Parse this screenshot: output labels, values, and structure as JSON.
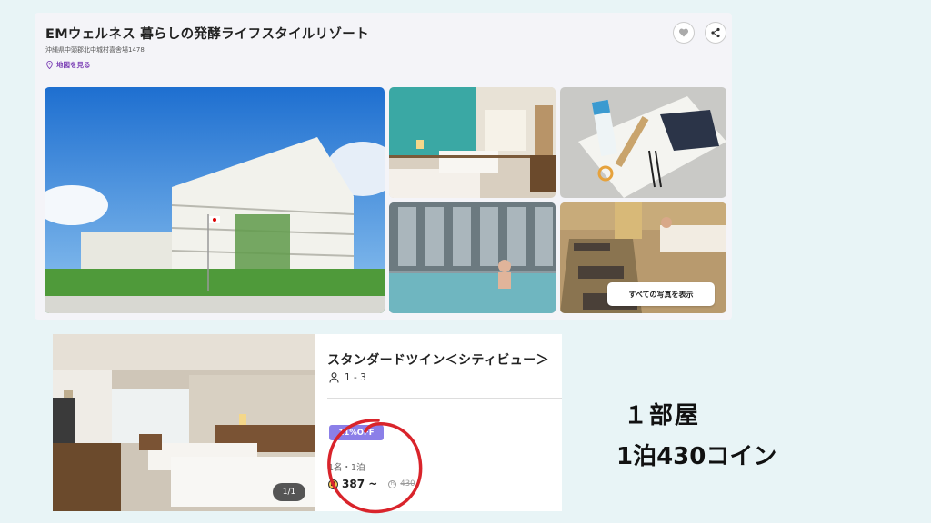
{
  "hotel": {
    "title": "EMウェルネス 暮らしの発酵ライフスタイルリゾート",
    "address": "沖縄県中頭郡北中城村喜舎場1478",
    "map_link": "地図を見る",
    "favorite_icon": "heart-icon",
    "share_icon": "share-icon",
    "show_all_photos": "すべての写真を表示"
  },
  "room": {
    "name": "スタンダードツイン＜シティビュー＞",
    "capacity": "1 - 3",
    "photo_counter": "1/1",
    "discount_badge": "11%OFF",
    "plan": "1名・1泊",
    "price": "387 ~",
    "original_price": "430"
  },
  "annotation": {
    "line1": "１部屋",
    "line2": "1泊430コイン",
    "circle_color": "#d9242b"
  },
  "colors": {
    "accent_purple": "#7b3fb5",
    "badge": "#8b7fe8",
    "background": "#e8f4f6"
  }
}
